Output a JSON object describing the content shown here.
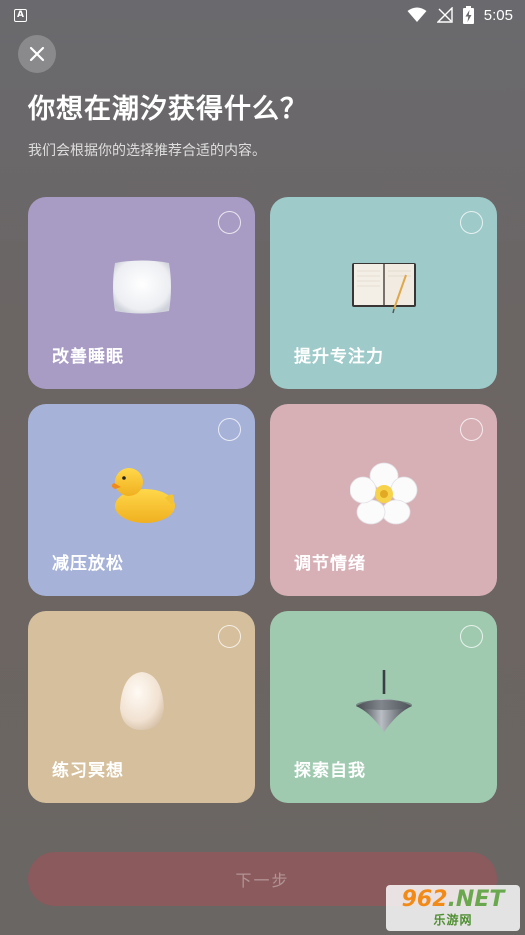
{
  "status_bar": {
    "app_icon": "A",
    "time": "5:05",
    "icons": [
      "wifi-icon",
      "no-signal-icon",
      "battery-charging-icon"
    ]
  },
  "header": {
    "title": "你想在潮汐获得什么？",
    "subtitle": "我们会根据你的选择推荐合适的内容。"
  },
  "options": [
    {
      "label": "改善睡眠",
      "color": "#a99cc4",
      "icon": "pillow-icon",
      "selected": false
    },
    {
      "label": "提升专注力",
      "color": "#9ecac9",
      "icon": "notebook-icon",
      "selected": false
    },
    {
      "label": "减压放松",
      "color": "#a6b2d8",
      "icon": "rubber-duck-icon",
      "selected": false
    },
    {
      "label": "调节情绪",
      "color": "#d7b0b6",
      "icon": "flower-icon",
      "selected": false
    },
    {
      "label": "练习冥想",
      "color": "#d5bf9c",
      "icon": "egg-icon",
      "selected": false
    },
    {
      "label": "探索自我",
      "color": "#9fcab0",
      "icon": "spinning-top-icon",
      "selected": false
    }
  ],
  "footer": {
    "next_label": "下一步"
  },
  "watermark": {
    "number": "962",
    "suffix": ".NET",
    "caption": "乐游网"
  },
  "colors": {
    "next_button": "#8a5a5d"
  }
}
